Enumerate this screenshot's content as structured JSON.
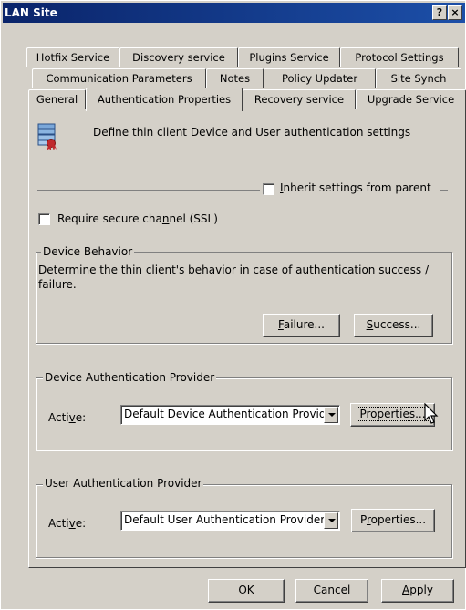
{
  "window": {
    "title": "LAN Site",
    "help_glyph": "?",
    "close_glyph": "×"
  },
  "tabs": {
    "row1": [
      "Hotfix Service",
      "Discovery service",
      "Plugins Service",
      "Protocol Settings"
    ],
    "row2": [
      "Communication Parameters",
      "Notes",
      "Policy Updater",
      "Site Synch"
    ],
    "row3": [
      "General",
      "Authentication Properties",
      "Recovery service",
      "Upgrade Service"
    ],
    "active": "Authentication Properties"
  },
  "header": {
    "icon": "certificate-settings-icon",
    "description": "Define thin client Device and User authentication settings"
  },
  "inherit": {
    "label_pre": "",
    "label_u": "I",
    "label_post": "nherit settings from parent",
    "checked": false
  },
  "ssl": {
    "label_pre": "Require secure cha",
    "label_u": "n",
    "label_post": "nel (SSL)",
    "checked": false
  },
  "device_behavior": {
    "title": "Device Behavior",
    "text_line1": "Determine the thin client's behavior in case of authentication success /",
    "text_line2": "failure.",
    "failure": {
      "u": "F",
      "rest": "ailure..."
    },
    "success": {
      "u": "S",
      "rest": "uccess..."
    }
  },
  "device_auth": {
    "title": "Device Authentication Provider",
    "active_pre": "Acti",
    "active_u": "v",
    "active_post": "e:",
    "selected": "Default Device Authentication Provider",
    "properties": {
      "u": "P",
      "rest": "roperties..."
    }
  },
  "user_auth": {
    "title": "User Authentication Provider",
    "active_pre": "Acti",
    "active_u": "v",
    "active_post": "e:",
    "selected": "Default User Authentication Provider",
    "properties_pre": "P",
    "properties_u": "r",
    "properties_post": "operties..."
  },
  "footer": {
    "ok": "OK",
    "cancel": "Cancel",
    "apply_u": "A",
    "apply_rest": "pply"
  }
}
